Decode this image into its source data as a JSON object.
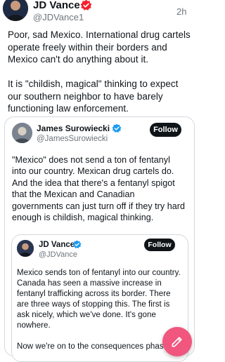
{
  "post": {
    "author": {
      "name": "JD Vance",
      "handle": "@JDVance1",
      "time": "2h"
    },
    "text": "Poor, sad Mexico. International drug cartels operate freely within their borders and Mexico can't do anything about it.\n\nIt is \"childish, magical\" thinking to expect our southern neighbor to have barely functioning law enforcement."
  },
  "quote": {
    "author": {
      "name": "James Surowiecki",
      "handle": "@JamesSurowiecki",
      "follow_label": "Follow"
    },
    "text": "\"Mexico\" does not send a ton of fentanyl into our country. Mexican drug cartels do. And the idea that there's a fentanyl spigot that the Mexican and Canadian governments can just turn off if they try hard enough is childish, magical thinking."
  },
  "nested_quote": {
    "author": {
      "name": "JD Vance",
      "handle": "@JDVance",
      "follow_label": "Follow"
    },
    "text": "Mexico sends ton of fentanyl into our country. Canada has seen a massive increase in fentanyl trafficking across its border. There are three ways of stopping this. The first is ask nicely, which we've done. It's gone nowhere.\n\nNow we're on to the consequences phase."
  },
  "colors": {
    "verified": "#1d9bf0",
    "badge_red": "#f4212e",
    "fab": "#f0567e"
  },
  "icons": {
    "compose": "compose-icon",
    "verified": "verified-badge-icon"
  }
}
